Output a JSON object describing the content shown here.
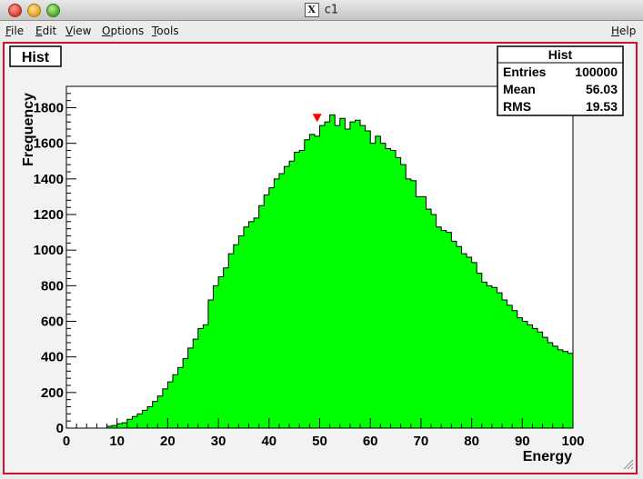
{
  "window": {
    "title": "c1",
    "title_icon": "x11-icon"
  },
  "menu": {
    "file": "File",
    "edit": "Edit",
    "view": "View",
    "options": "Options",
    "tools": "Tools",
    "help": "Help"
  },
  "colors": {
    "frame_border": "#cc1133",
    "fill": "#00ff00",
    "marker": "#ff0000",
    "background": "#f2f2f2"
  },
  "stats": {
    "title": "Hist",
    "entries_label": "Entries",
    "entries_value": "100000",
    "mean_label": "Mean",
    "mean_value": "56.03",
    "rms_label": "RMS",
    "rms_value": "19.53"
  },
  "chart_data": {
    "type": "bar",
    "title": "Hist",
    "xlabel": "Energy",
    "ylabel": "Frequency",
    "xlim": [
      0,
      100
    ],
    "ylim": [
      0,
      1920
    ],
    "x_ticks": [
      0,
      10,
      20,
      30,
      40,
      50,
      60,
      70,
      80,
      90,
      100
    ],
    "y_ticks": [
      0,
      200,
      400,
      600,
      800,
      1000,
      1200,
      1400,
      1600,
      1800
    ],
    "bin_width": 1,
    "grid": false,
    "fill_color": "#00ff00",
    "marker": {
      "x": 49.5,
      "y": 1745,
      "color": "#ff0000"
    },
    "values": [
      0,
      0,
      0,
      0,
      0,
      0,
      0,
      0,
      10,
      15,
      25,
      30,
      50,
      65,
      80,
      100,
      120,
      150,
      180,
      220,
      260,
      300,
      340,
      390,
      450,
      500,
      560,
      580,
      720,
      800,
      850,
      900,
      980,
      1030,
      1080,
      1130,
      1160,
      1180,
      1250,
      1310,
      1350,
      1400,
      1430,
      1470,
      1500,
      1550,
      1560,
      1620,
      1650,
      1640,
      1700,
      1720,
      1760,
      1700,
      1740,
      1680,
      1720,
      1730,
      1700,
      1670,
      1600,
      1640,
      1600,
      1570,
      1560,
      1520,
      1480,
      1400,
      1390,
      1300,
      1300,
      1230,
      1200,
      1130,
      1110,
      1100,
      1050,
      1020,
      980,
      960,
      930,
      870,
      820,
      800,
      790,
      760,
      720,
      690,
      660,
      620,
      600,
      580,
      560,
      540,
      510,
      480,
      460,
      440,
      430,
      420
    ]
  }
}
